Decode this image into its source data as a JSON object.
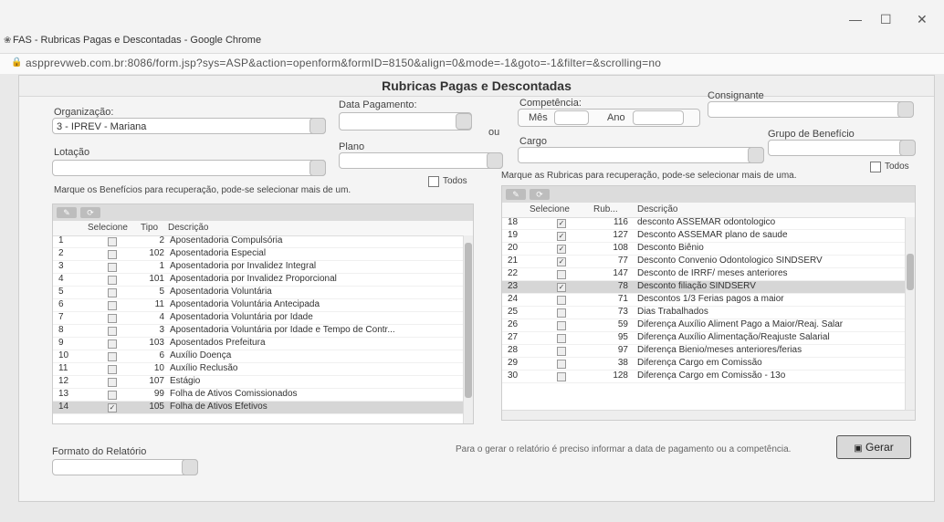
{
  "window": {
    "title": "FAS - Rubricas Pagas e Descontadas - Google Chrome",
    "url": "aspprevweb.com.br:8086/form.jsp?sys=ASP&action=openform&formID=8150&align=0&mode=-1&goto=-1&filter=&scrolling=no"
  },
  "form": {
    "heading": "Rubricas Pagas e Descontadas",
    "organizacao_label": "Organização:",
    "organizacao_value": "3 - IPREV - Mariana",
    "data_pagamento_label": "Data Pagamento:",
    "ou_label": "ou",
    "competencia_label": "Competência:",
    "mes_label": "Mês",
    "ano_label": "Ano",
    "consignante_label": "Consignante",
    "lotacao_label": "Lotação",
    "plano_label": "Plano",
    "cargo_label": "Cargo",
    "grupo_beneficio_label": "Grupo de Benefício",
    "beneficios_hint": "Marque os Benefícios para recuperação, pode-se selecionar mais de um.",
    "rubricas_hint": "Marque as Rubricas para recuperação, pode-se selecionar mais de uma.",
    "todos_label": "Todos",
    "formato_label": "Formato do Relatório",
    "gerar_hint": "Para o gerar o relatório é preciso informar a data de pagamento ou a competência.",
    "gerar_label": "Gerar"
  },
  "beneficios_grid": {
    "headers": {
      "selecione": "Selecione",
      "tipo": "Tipo",
      "descricao": "Descrição"
    },
    "rows": [
      {
        "n": "1",
        "checked": false,
        "code": "2",
        "desc": "Aposentadoria Compulsória"
      },
      {
        "n": "2",
        "checked": false,
        "code": "102",
        "desc": "Aposentadoria Especial"
      },
      {
        "n": "3",
        "checked": false,
        "code": "1",
        "desc": "Aposentadoria por Invalidez Integral"
      },
      {
        "n": "4",
        "checked": false,
        "code": "101",
        "desc": "Aposentadoria por Invalidez Proporcional"
      },
      {
        "n": "5",
        "checked": false,
        "code": "5",
        "desc": "Aposentadoria Voluntária"
      },
      {
        "n": "6",
        "checked": false,
        "code": "11",
        "desc": "Aposentadoria Voluntária Antecipada"
      },
      {
        "n": "7",
        "checked": false,
        "code": "4",
        "desc": "Aposentadoria Voluntária por Idade"
      },
      {
        "n": "8",
        "checked": false,
        "code": "3",
        "desc": "Aposentadoria Voluntária por Idade e Tempo de Contr..."
      },
      {
        "n": "9",
        "checked": false,
        "code": "103",
        "desc": "Aposentados Prefeitura"
      },
      {
        "n": "10",
        "checked": false,
        "code": "6",
        "desc": "Auxílio Doença"
      },
      {
        "n": "11",
        "checked": false,
        "code": "10",
        "desc": "Auxílio Reclusão"
      },
      {
        "n": "12",
        "checked": false,
        "code": "107",
        "desc": "Estágio"
      },
      {
        "n": "13",
        "checked": false,
        "code": "99",
        "desc": "Folha de Ativos Comissionados"
      },
      {
        "n": "14",
        "checked": true,
        "code": "105",
        "desc": "Folha de Ativos Efetivos"
      }
    ]
  },
  "rubricas_grid": {
    "headers": {
      "selecione": "Selecione",
      "rub": "Rub...",
      "descricao": "Descrição"
    },
    "rows": [
      {
        "n": "18",
        "checked": true,
        "code": "116",
        "desc": "desconto ASSEMAR odontologico"
      },
      {
        "n": "19",
        "checked": true,
        "code": "127",
        "desc": "Desconto ASSEMAR plano de saude"
      },
      {
        "n": "20",
        "checked": true,
        "code": "108",
        "desc": "Desconto Biênio"
      },
      {
        "n": "21",
        "checked": true,
        "code": "77",
        "desc": "Desconto Convenio Odontologico SINDSERV"
      },
      {
        "n": "22",
        "checked": false,
        "code": "147",
        "desc": "Desconto de IRRF/ meses anteriores"
      },
      {
        "n": "23",
        "checked": true,
        "code": "78",
        "desc": "Desconto filiação SINDSERV"
      },
      {
        "n": "24",
        "checked": false,
        "code": "71",
        "desc": "Descontos 1/3 Ferias pagos a maior"
      },
      {
        "n": "25",
        "checked": false,
        "code": "73",
        "desc": "Dias Trabalhados"
      },
      {
        "n": "26",
        "checked": false,
        "code": "59",
        "desc": "Diferença Auxílio Aliment Pago a Maior/Reaj. Salar"
      },
      {
        "n": "27",
        "checked": false,
        "code": "95",
        "desc": "Diferença Auxílio Alimentação/Reajuste Salarial"
      },
      {
        "n": "28",
        "checked": false,
        "code": "97",
        "desc": "Diferença Bienio/meses anteriores/ferias"
      },
      {
        "n": "29",
        "checked": false,
        "code": "38",
        "desc": "Diferença Cargo em Comissão"
      },
      {
        "n": "30",
        "checked": false,
        "code": "128",
        "desc": "Diferença Cargo em Comissão - 13o"
      }
    ]
  }
}
